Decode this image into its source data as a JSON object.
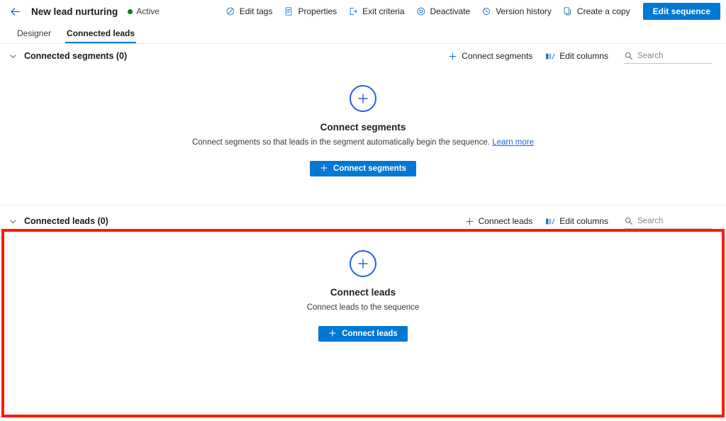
{
  "header": {
    "back_icon": "back-arrow-icon",
    "title": "New lead nurturing",
    "status": "Active",
    "status_color": "#107c10",
    "commands": [
      {
        "label": "Edit tags",
        "icon": "tag-icon"
      },
      {
        "label": "Properties",
        "icon": "document-properties-icon"
      },
      {
        "label": "Exit criteria",
        "icon": "exit-icon"
      },
      {
        "label": "Deactivate",
        "icon": "stop-circle-icon"
      },
      {
        "label": "Version history",
        "icon": "history-clock-icon"
      },
      {
        "label": "Create a copy",
        "icon": "copy-pages-icon"
      }
    ],
    "primary_button": "Edit sequence",
    "primary_color": "#0078d4"
  },
  "tabs": [
    {
      "label": "Designer",
      "selected": false
    },
    {
      "label": "Connected leads",
      "selected": true
    }
  ],
  "sections": [
    {
      "title": "Connected segments (0)",
      "chevron_icon": "chevron-down-icon",
      "actions": [
        {
          "label": "Connect segments",
          "icon": "plus-icon"
        },
        {
          "label": "Edit columns",
          "icon": "edit-columns-icon"
        }
      ],
      "search": {
        "placeholder": "Search",
        "value": "",
        "icon": "search-icon"
      },
      "empty": {
        "icon": "plus-circle-icon",
        "title": "Connect segments",
        "description": "Connect segments so that leads in the segment automatically begin the sequence.",
        "link": "Learn more",
        "button": "Connect segments"
      }
    },
    {
      "title": "Connected leads (0)",
      "chevron_icon": "chevron-down-icon",
      "actions": [
        {
          "label": "Connect leads",
          "icon": "plus-icon"
        },
        {
          "label": "Edit columns",
          "icon": "edit-columns-icon"
        }
      ],
      "search": {
        "placeholder": "Search",
        "value": "",
        "icon": "search-icon"
      },
      "empty": {
        "icon": "plus-circle-icon",
        "title": "Connect leads",
        "description": "Connect leads to the sequence",
        "link": "",
        "button": "Connect leads"
      }
    }
  ],
  "annotation": {
    "highlight_color": "#ff1a00"
  }
}
